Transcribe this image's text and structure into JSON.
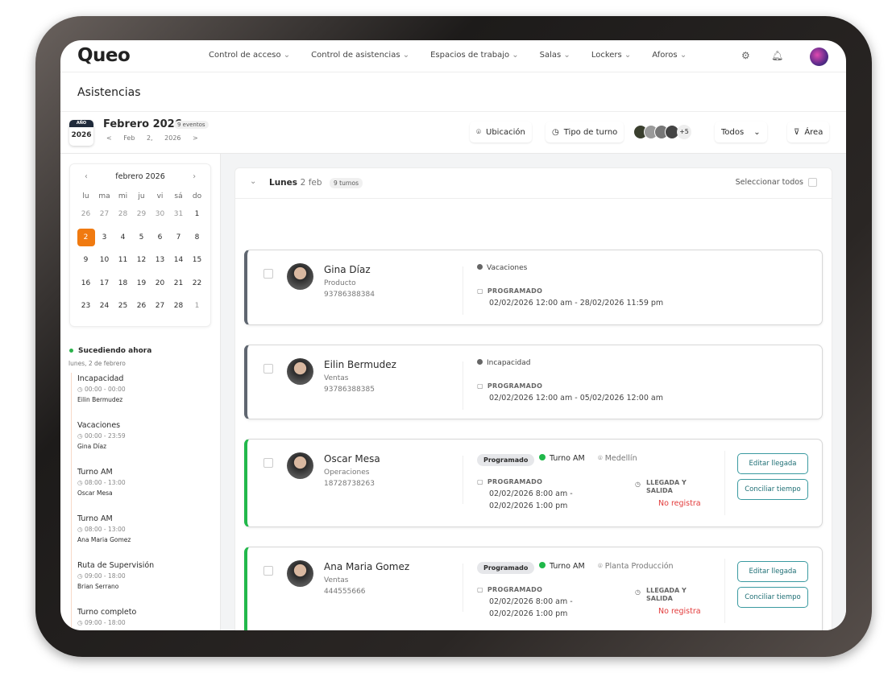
{
  "app": {
    "logo": "Queo",
    "page_title": "Asistencias"
  },
  "nav": {
    "items": [
      "Control de acceso",
      "Control de asistencias",
      "Espacios de trabajo",
      "Salas",
      "Lockers",
      "Aforos"
    ]
  },
  "header": {
    "year_label": "AÑO",
    "year": "2026",
    "month": "Febrero 2026",
    "events_badge": "9 eventos",
    "date": "Feb 2, 2026",
    "prev": "<",
    "next": ">"
  },
  "toolbar": {
    "ubicacion": "Ubicación",
    "tipo_turno": "Tipo de turno",
    "avatars_more": "+5",
    "todos": "Todos",
    "area": "Área"
  },
  "calendar": {
    "title": "febrero 2026",
    "weekdays": [
      "lu",
      "ma",
      "mi",
      "ju",
      "vi",
      "sá",
      "do"
    ],
    "days": [
      [
        "26",
        "27",
        "28",
        "29",
        "30",
        "31",
        "1"
      ],
      [
        "2",
        "3",
        "4",
        "5",
        "6",
        "7",
        "8"
      ],
      [
        "9",
        "10",
        "11",
        "12",
        "13",
        "14",
        "15"
      ],
      [
        "16",
        "17",
        "18",
        "19",
        "20",
        "21",
        "22"
      ],
      [
        "23",
        "24",
        "25",
        "26",
        "27",
        "28",
        "1"
      ]
    ],
    "selected": "2"
  },
  "now": {
    "title": "Sucediendo ahora",
    "date": "lunes, 2 de febrero",
    "events": [
      {
        "name": "Incapacidad",
        "time": "00:00 - 00:00",
        "person": "Eilin Bermudez"
      },
      {
        "name": "Vacaciones",
        "time": "00:00 - 23:59",
        "person": "Gina Díaz"
      },
      {
        "name": "Turno AM",
        "time": "08:00 - 13:00",
        "person": "Oscar Mesa"
      },
      {
        "name": "Turno AM",
        "time": "08:00 - 13:00",
        "person": "Ana Maria Gomez"
      },
      {
        "name": "Ruta de Supervisión",
        "time": "09:00 - 18:00",
        "person": "Brian Serrano"
      },
      {
        "name": "Turno completo",
        "time": "09:00 - 18:00",
        "person": ""
      }
    ]
  },
  "day": {
    "name": "Lunes",
    "date": "2 feb",
    "count": "9 turnos",
    "select_all": "Seleccionar todos"
  },
  "cards": [
    {
      "name": "Gina Díaz",
      "dept": "Producto",
      "phone": "93786388384",
      "status": "Vacaciones",
      "label": "PROGRAMADO",
      "range": "02/02/2026 12:00 am - 28/02/2026 11:59 pm",
      "accent": "#5f6670"
    },
    {
      "name": "Eilin Bermudez",
      "dept": "Ventas",
      "phone": "93786388385",
      "status": "Incapacidad",
      "label": "PROGRAMADO",
      "range": "02/02/2026 12:00 am - 05/02/2026 12:00 am",
      "accent": "#5f6670"
    },
    {
      "name": "Oscar Mesa",
      "dept": "Operaciones",
      "phone": "18728738263",
      "pill": "Programado",
      "turno": "Turno AM",
      "location": "Medellín",
      "label": "PROGRAMADO",
      "range1": "02/02/2026 8:00 am -",
      "range2": "02/02/2026 1:00 pm",
      "ll1": "LLEGADA Y",
      "ll2": "SALIDA",
      "no": "No registra",
      "btn1": "Editar llegada",
      "btn2": "Conciliar tiempo",
      "accent": "#22b84b"
    },
    {
      "name": "Ana Maria Gomez",
      "dept": "Ventas",
      "phone": "444555666",
      "pill": "Programado",
      "turno": "Turno AM",
      "location": "Planta Producción",
      "label": "PROGRAMADO",
      "range1": "02/02/2026 8:00 am -",
      "range2": "02/02/2026 1:00 pm",
      "ll1": "LLEGADA Y",
      "ll2": "SALIDA",
      "no": "No registra",
      "btn1": "Editar llegada",
      "btn2": "Conciliar tiempo",
      "accent": "#22b84b"
    }
  ]
}
